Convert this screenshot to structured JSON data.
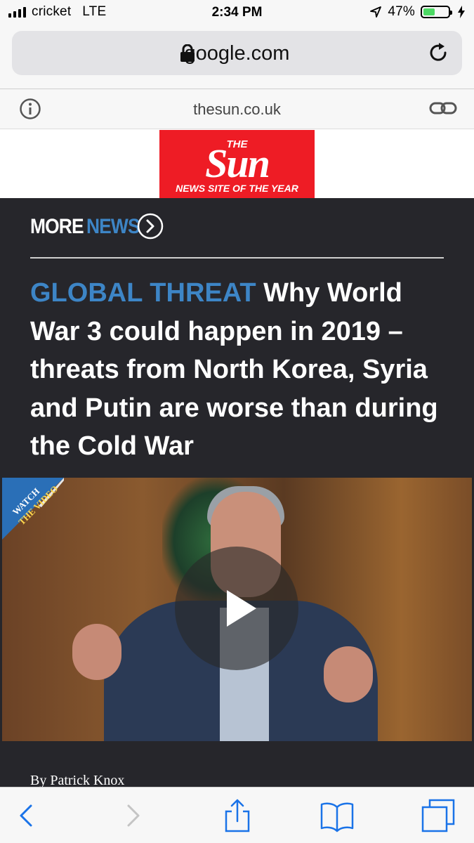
{
  "status_bar": {
    "carrier": "cricket",
    "network": "LTE",
    "time": "2:34 PM",
    "battery_text": "47%",
    "battery_level": 0.47,
    "battery_color": "#4cd964",
    "icons": [
      "signal-bars-icon",
      "location-arrow-icon",
      "battery-icon",
      "charging-bolt-icon"
    ]
  },
  "url_bar": {
    "domain": "google.com",
    "icons": [
      "lock-icon",
      "reload-icon"
    ]
  },
  "site_bar": {
    "site": "thesun.co.uk",
    "icons": [
      "info-icon",
      "link-icon"
    ]
  },
  "logo": {
    "the": "THE",
    "word": "Sun",
    "tagline": "NEWS SITE OF THE YEAR",
    "background": "#ee1c25"
  },
  "article": {
    "section_more": "MORE",
    "section_news": "NEWS",
    "kicker": "GLOBAL THREAT",
    "headline": "Why World War 3 could happen in 2019 – threats from North Korea, Syria and Putin are worse than during the Cold War",
    "badge_line1": "WATCH",
    "badge_line2": "THE VIDEO",
    "byline": "By Patrick Knox",
    "accent_color": "#3d85c6",
    "background": "#26262b"
  },
  "toolbar": {
    "icons": [
      "back-arrow-icon",
      "forward-arrow-icon",
      "share-icon",
      "bookmarks-icon",
      "tabs-icon"
    ]
  }
}
